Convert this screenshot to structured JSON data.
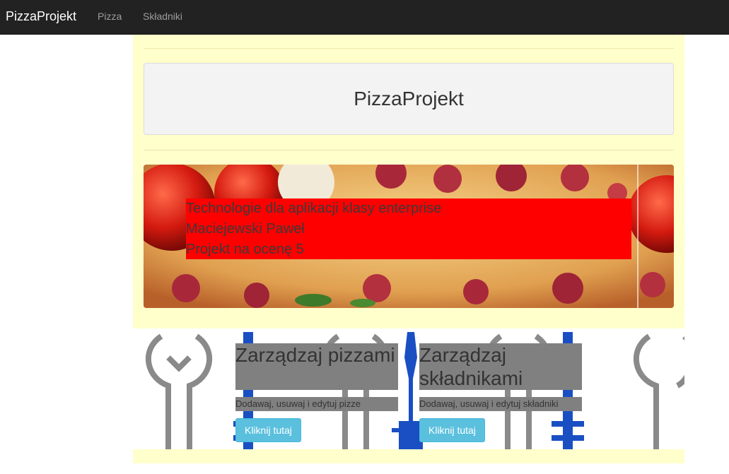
{
  "navbar": {
    "brand": "PizzaProjekt",
    "links": [
      "Pizza",
      "Składniki"
    ]
  },
  "jumbotron": {
    "title": "PizzaProjekt"
  },
  "banner": {
    "lines": [
      "Technologie dla aplikacji klasy enterprise",
      "Maciejewski Paweł",
      "Projekt na ocenę 5"
    ]
  },
  "cards": [
    {
      "title": "Zarządzaj pizzami",
      "description": "Dodawaj, usuwaj i edytuj pizze",
      "button": "Kliknij tutaj"
    },
    {
      "title": "Zarządzaj składnikami",
      "description": "Dodawaj, usuwaj i edytuj składniki",
      "button": "Kliknij tutaj"
    }
  ],
  "colors": {
    "navbar": "#222222",
    "page_bg": "#ffffcc",
    "caption_bg": "#ff0000",
    "button": "#5bc0de",
    "card_bg": "#808080",
    "tool_blue": "#1a4fc4"
  },
  "icons": [
    "wrench-icon",
    "fork-icon"
  ]
}
